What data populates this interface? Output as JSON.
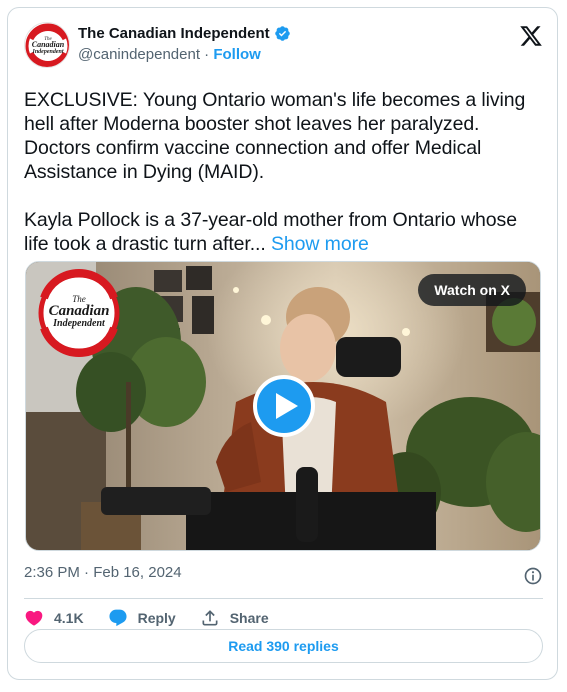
{
  "author": {
    "name": "The Canadian Independent",
    "handle": "@canindependent",
    "separator": "·",
    "follow_label": "Follow",
    "avatar_logo_lines": [
      "The",
      "Canadian",
      "Independent"
    ]
  },
  "tweet": {
    "paragraph1": "EXCLUSIVE: Young Ontario woman's life becomes a living hell after Moderna booster shot leaves her paralyzed. Doctors confirm vaccine connection and offer Medical Assistance in Dying (MAID).",
    "paragraph2": "Kayla Pollock is a 37-year-old mother from Ontario whose life took a drastic turn after...",
    "show_more_label": "Show more"
  },
  "media": {
    "watch_label": "Watch on X",
    "watermark_lines": [
      "The",
      "Canadian",
      "Independent"
    ]
  },
  "meta": {
    "timestamp": "2:36 PM · Feb 16, 2024"
  },
  "actions": {
    "like_count": "4.1K",
    "reply_label": "Reply",
    "share_label": "Share"
  },
  "replies_button_label": "Read 390 replies",
  "colors": {
    "accent": "#1d9bf0",
    "like": "#f91880",
    "text": "#0f1419",
    "muted": "#536471",
    "border": "#cfd9de",
    "logo_red": "#d71920"
  },
  "icons": {
    "verified": "verified-badge-icon",
    "platform": "x-logo-icon",
    "info": "info-icon",
    "like": "heart-icon",
    "reply": "reply-bubble-icon",
    "share": "share-upload-icon",
    "play": "play-icon"
  }
}
